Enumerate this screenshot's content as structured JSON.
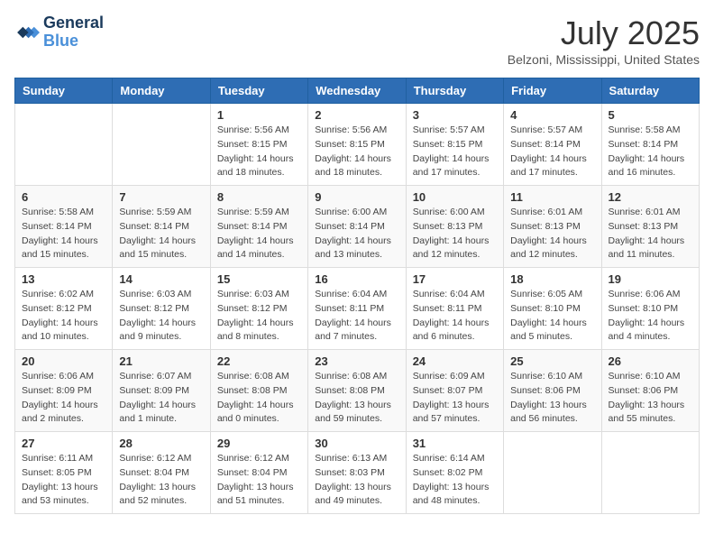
{
  "header": {
    "logo_line1": "General",
    "logo_line2": "Blue",
    "month_year": "July 2025",
    "location": "Belzoni, Mississippi, United States"
  },
  "weekdays": [
    "Sunday",
    "Monday",
    "Tuesday",
    "Wednesday",
    "Thursday",
    "Friday",
    "Saturday"
  ],
  "weeks": [
    [
      {
        "day": "",
        "info": ""
      },
      {
        "day": "",
        "info": ""
      },
      {
        "day": "1",
        "info": "Sunrise: 5:56 AM\nSunset: 8:15 PM\nDaylight: 14 hours\nand 18 minutes."
      },
      {
        "day": "2",
        "info": "Sunrise: 5:56 AM\nSunset: 8:15 PM\nDaylight: 14 hours\nand 18 minutes."
      },
      {
        "day": "3",
        "info": "Sunrise: 5:57 AM\nSunset: 8:15 PM\nDaylight: 14 hours\nand 17 minutes."
      },
      {
        "day": "4",
        "info": "Sunrise: 5:57 AM\nSunset: 8:14 PM\nDaylight: 14 hours\nand 17 minutes."
      },
      {
        "day": "5",
        "info": "Sunrise: 5:58 AM\nSunset: 8:14 PM\nDaylight: 14 hours\nand 16 minutes."
      }
    ],
    [
      {
        "day": "6",
        "info": "Sunrise: 5:58 AM\nSunset: 8:14 PM\nDaylight: 14 hours\nand 15 minutes."
      },
      {
        "day": "7",
        "info": "Sunrise: 5:59 AM\nSunset: 8:14 PM\nDaylight: 14 hours\nand 15 minutes."
      },
      {
        "day": "8",
        "info": "Sunrise: 5:59 AM\nSunset: 8:14 PM\nDaylight: 14 hours\nand 14 minutes."
      },
      {
        "day": "9",
        "info": "Sunrise: 6:00 AM\nSunset: 8:14 PM\nDaylight: 14 hours\nand 13 minutes."
      },
      {
        "day": "10",
        "info": "Sunrise: 6:00 AM\nSunset: 8:13 PM\nDaylight: 14 hours\nand 12 minutes."
      },
      {
        "day": "11",
        "info": "Sunrise: 6:01 AM\nSunset: 8:13 PM\nDaylight: 14 hours\nand 12 minutes."
      },
      {
        "day": "12",
        "info": "Sunrise: 6:01 AM\nSunset: 8:13 PM\nDaylight: 14 hours\nand 11 minutes."
      }
    ],
    [
      {
        "day": "13",
        "info": "Sunrise: 6:02 AM\nSunset: 8:12 PM\nDaylight: 14 hours\nand 10 minutes."
      },
      {
        "day": "14",
        "info": "Sunrise: 6:03 AM\nSunset: 8:12 PM\nDaylight: 14 hours\nand 9 minutes."
      },
      {
        "day": "15",
        "info": "Sunrise: 6:03 AM\nSunset: 8:12 PM\nDaylight: 14 hours\nand 8 minutes."
      },
      {
        "day": "16",
        "info": "Sunrise: 6:04 AM\nSunset: 8:11 PM\nDaylight: 14 hours\nand 7 minutes."
      },
      {
        "day": "17",
        "info": "Sunrise: 6:04 AM\nSunset: 8:11 PM\nDaylight: 14 hours\nand 6 minutes."
      },
      {
        "day": "18",
        "info": "Sunrise: 6:05 AM\nSunset: 8:10 PM\nDaylight: 14 hours\nand 5 minutes."
      },
      {
        "day": "19",
        "info": "Sunrise: 6:06 AM\nSunset: 8:10 PM\nDaylight: 14 hours\nand 4 minutes."
      }
    ],
    [
      {
        "day": "20",
        "info": "Sunrise: 6:06 AM\nSunset: 8:09 PM\nDaylight: 14 hours\nand 2 minutes."
      },
      {
        "day": "21",
        "info": "Sunrise: 6:07 AM\nSunset: 8:09 PM\nDaylight: 14 hours\nand 1 minute."
      },
      {
        "day": "22",
        "info": "Sunrise: 6:08 AM\nSunset: 8:08 PM\nDaylight: 14 hours\nand 0 minutes."
      },
      {
        "day": "23",
        "info": "Sunrise: 6:08 AM\nSunset: 8:08 PM\nDaylight: 13 hours\nand 59 minutes."
      },
      {
        "day": "24",
        "info": "Sunrise: 6:09 AM\nSunset: 8:07 PM\nDaylight: 13 hours\nand 57 minutes."
      },
      {
        "day": "25",
        "info": "Sunrise: 6:10 AM\nSunset: 8:06 PM\nDaylight: 13 hours\nand 56 minutes."
      },
      {
        "day": "26",
        "info": "Sunrise: 6:10 AM\nSunset: 8:06 PM\nDaylight: 13 hours\nand 55 minutes."
      }
    ],
    [
      {
        "day": "27",
        "info": "Sunrise: 6:11 AM\nSunset: 8:05 PM\nDaylight: 13 hours\nand 53 minutes."
      },
      {
        "day": "28",
        "info": "Sunrise: 6:12 AM\nSunset: 8:04 PM\nDaylight: 13 hours\nand 52 minutes."
      },
      {
        "day": "29",
        "info": "Sunrise: 6:12 AM\nSunset: 8:04 PM\nDaylight: 13 hours\nand 51 minutes."
      },
      {
        "day": "30",
        "info": "Sunrise: 6:13 AM\nSunset: 8:03 PM\nDaylight: 13 hours\nand 49 minutes."
      },
      {
        "day": "31",
        "info": "Sunrise: 6:14 AM\nSunset: 8:02 PM\nDaylight: 13 hours\nand 48 minutes."
      },
      {
        "day": "",
        "info": ""
      },
      {
        "day": "",
        "info": ""
      }
    ]
  ]
}
